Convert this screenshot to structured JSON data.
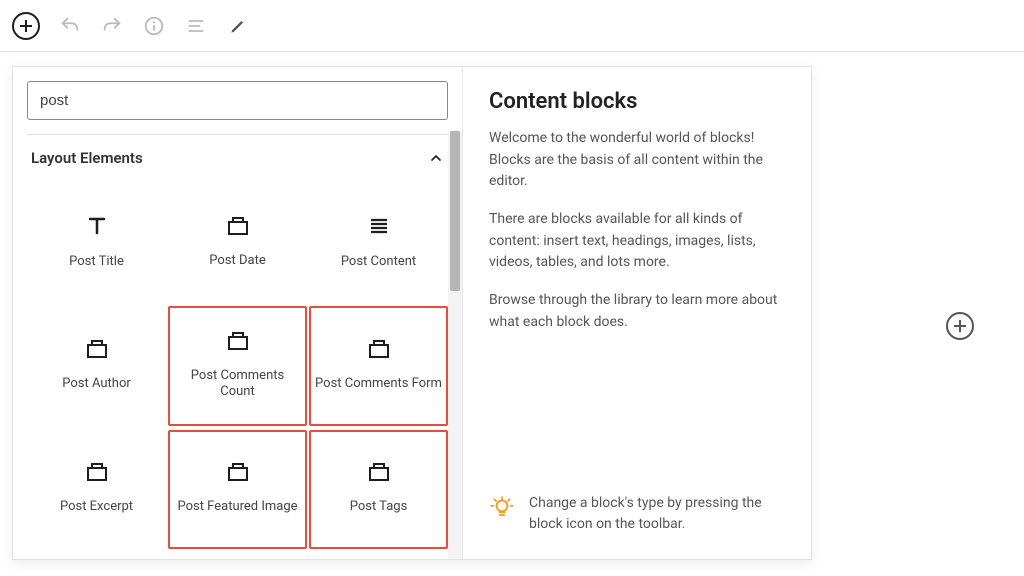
{
  "search": {
    "value": "post"
  },
  "section": {
    "title": "Layout Elements"
  },
  "blocks": [
    {
      "label": "Post Title",
      "icon": "title",
      "hl": false
    },
    {
      "label": "Post Date",
      "icon": "box",
      "hl": false
    },
    {
      "label": "Post Content",
      "icon": "lines",
      "hl": false
    },
    {
      "label": "Post Author",
      "icon": "box",
      "hl": false
    },
    {
      "label": "Post Comments Count",
      "icon": "box",
      "hl": true
    },
    {
      "label": "Post Comments Form",
      "icon": "box",
      "hl": true
    },
    {
      "label": "Post Excerpt",
      "icon": "box",
      "hl": false
    },
    {
      "label": "Post Featured Image",
      "icon": "box",
      "hl": true
    },
    {
      "label": "Post Tags",
      "icon": "box",
      "hl": true
    }
  ],
  "right": {
    "heading": "Content blocks",
    "p1": "Welcome to the wonderful world of blocks! Blocks are the basis of all content within the editor.",
    "p2": "There are blocks available for all kinds of content: insert text, headings, images, lists, videos, tables, and lots more.",
    "p3": "Browse through the library to learn more about what each block does.",
    "tip": "Change a block's type by pressing the block icon on the toolbar."
  }
}
